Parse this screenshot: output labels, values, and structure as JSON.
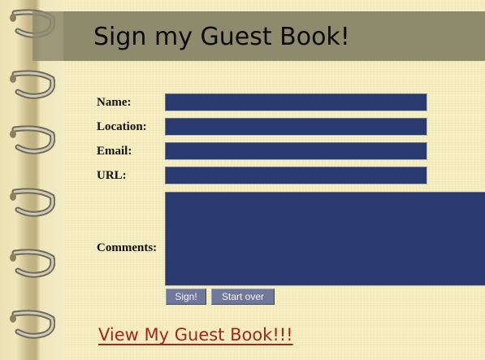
{
  "page": {
    "title": "Sign my Guest Book!"
  },
  "form": {
    "name_label": "Name:",
    "location_label": "Location:",
    "email_label": "Email:",
    "url_label": "URL:",
    "comments_label": "Comments:",
    "name_value": "",
    "location_value": "",
    "email_value": "",
    "url_value": "",
    "comments_value": "",
    "sign_button": "Sign!",
    "reset_button": "Start over"
  },
  "links": {
    "view_guestbook": "View My Guest Book!!!"
  },
  "colors": {
    "background": "#f6efc4",
    "title_band": "#8e8a6d",
    "field_fill": "#283a6e",
    "button_fill": "#6f789b",
    "link": "#a2261d"
  },
  "decor": {
    "binding_icon": "spiral-binding-icon",
    "ring_count": 7
  }
}
